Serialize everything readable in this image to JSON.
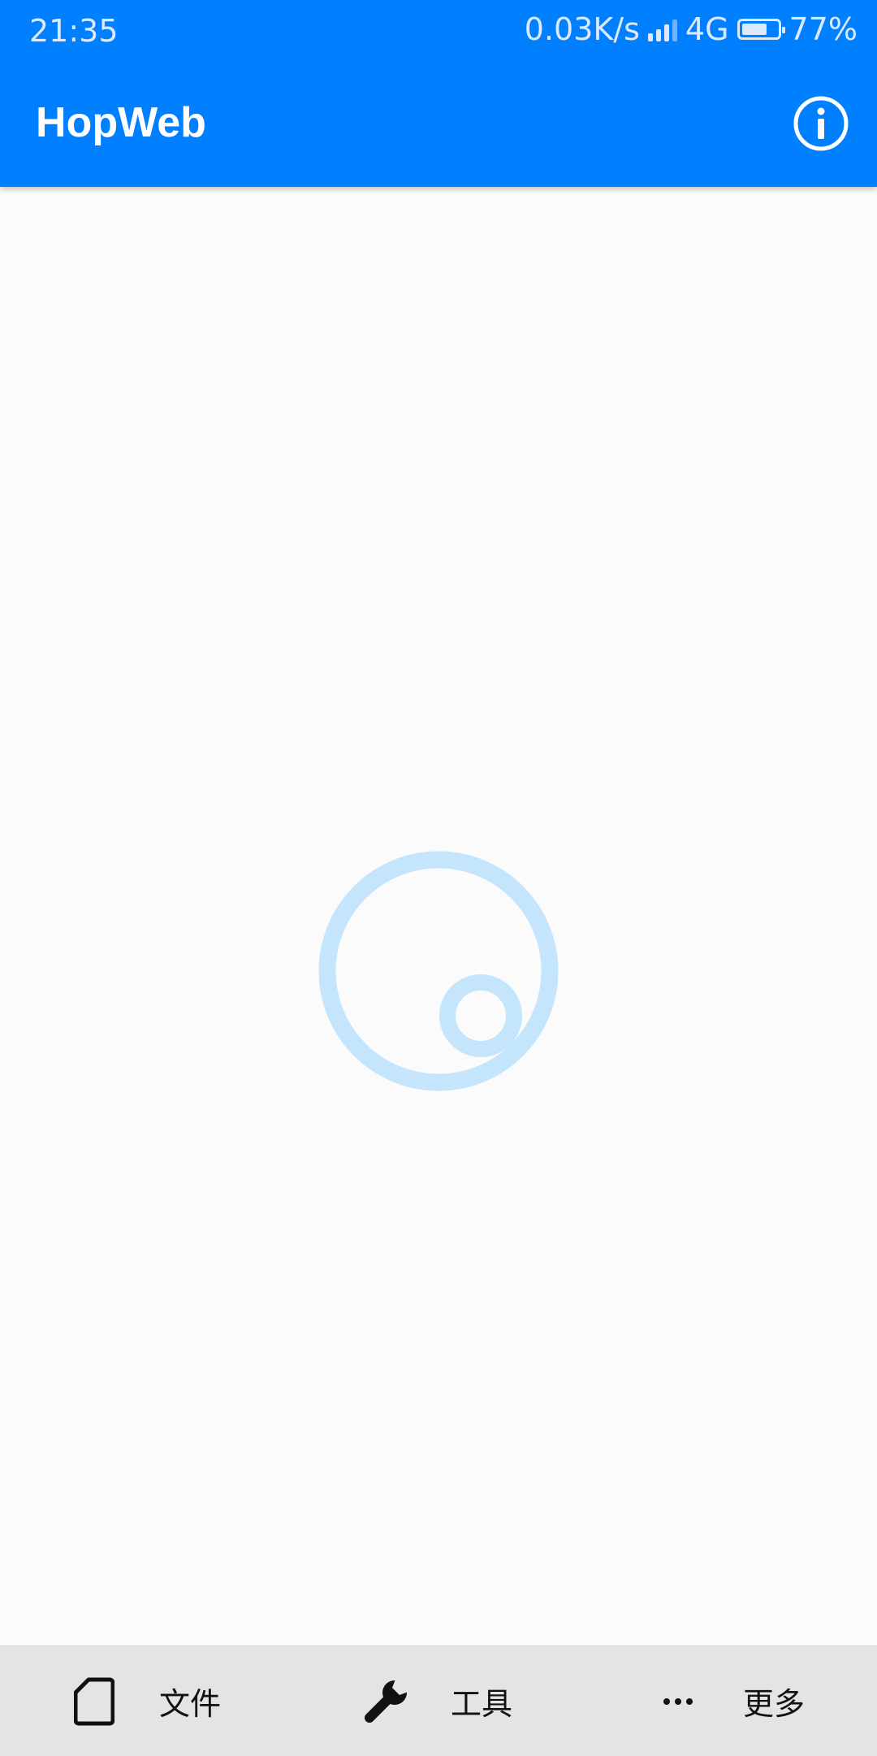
{
  "status_bar": {
    "corner_label": "",
    "time": "21:35",
    "speed": "0.03K/s",
    "network": "4G",
    "battery_level": 0.77,
    "battery_percent": "77%"
  },
  "app_bar": {
    "title": "HopWeb",
    "info_icon": "info-circle-icon"
  },
  "content": {
    "loading_indicator": "loading-spinner"
  },
  "bottom_nav": {
    "items": [
      {
        "icon": "file-icon",
        "label": "文件"
      },
      {
        "icon": "wrench-icon",
        "label": "工具"
      },
      {
        "icon": "more-dots-icon",
        "label": "更多"
      }
    ]
  },
  "colors": {
    "primary": "#007ffe",
    "background": "#fbfbfb",
    "spinner": "#c5e5fd",
    "bottom_bar": "#e4e4e4"
  }
}
